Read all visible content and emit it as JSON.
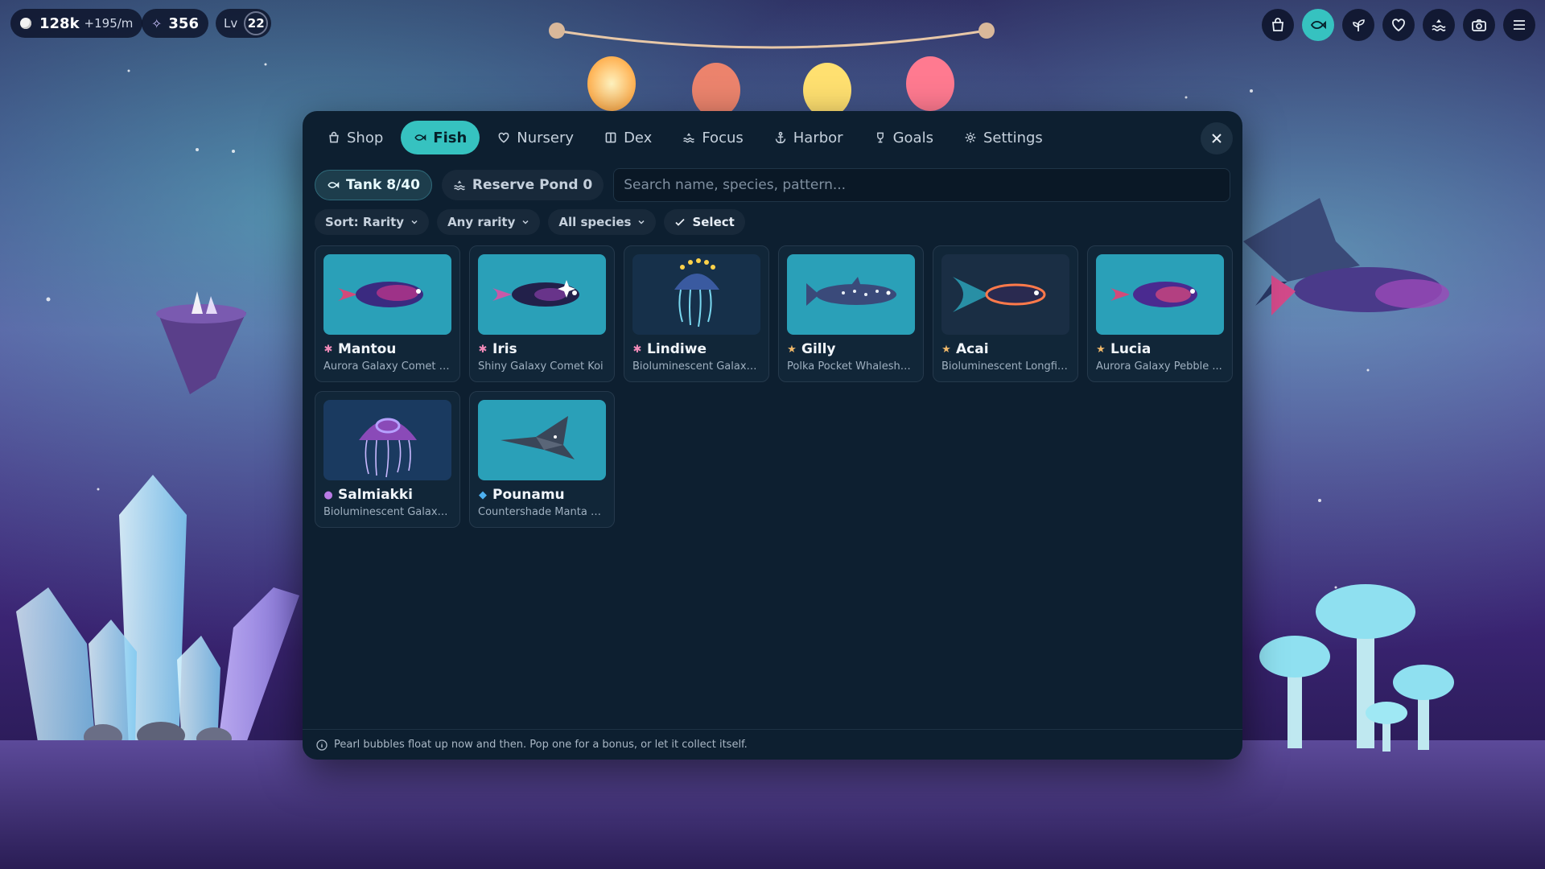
{
  "hud": {
    "coins": "128k",
    "coin_rate": "+195/m",
    "stardust": "356",
    "level_label": "Lv",
    "level": "22"
  },
  "top_rail": {
    "icons": [
      "shopping-bag-icon",
      "fish-icon",
      "sprout-icon",
      "heart-icon",
      "water-icon",
      "camera-icon",
      "menu-icon"
    ],
    "active": "fish-icon"
  },
  "tabs": [
    {
      "label": "Shop",
      "icon": "shopping-bag-icon"
    },
    {
      "label": "Fish",
      "icon": "fish-icon",
      "active": true
    },
    {
      "label": "Nursery",
      "icon": "heart-icon"
    },
    {
      "label": "Dex",
      "icon": "book-icon"
    },
    {
      "label": "Focus",
      "icon": "waves-icon"
    },
    {
      "label": "Harbor",
      "icon": "anchor-icon"
    },
    {
      "label": "Goals",
      "icon": "trophy-icon"
    },
    {
      "label": "Settings",
      "icon": "gear-icon"
    }
  ],
  "pond_toggle": {
    "tank_label": "Tank 8/40",
    "reserve_label": "Reserve Pond 0"
  },
  "search": {
    "placeholder": "Search name, species, pattern...",
    "value": ""
  },
  "filters": {
    "sort": "Sort: Rarity",
    "rarity": "Any rarity",
    "species": "All species",
    "select": "Select"
  },
  "fish": [
    {
      "name": "Mantou",
      "species": "Aurora Galaxy Comet K...",
      "rarity_icon": "✱",
      "rarity_color": "#f08ab8",
      "kind": "comet"
    },
    {
      "name": "Iris",
      "species": "Shiny Galaxy Comet Koi",
      "rarity_icon": "✱",
      "rarity_color": "#f08ab8",
      "kind": "koi-shiny"
    },
    {
      "name": "Lindiwe",
      "species": "Bioluminescent Galaxy ...",
      "rarity_icon": "✱",
      "rarity_color": "#f08ab8",
      "kind": "jelly-crown"
    },
    {
      "name": "Gilly",
      "species": "Polka Pocket Whalesha...",
      "rarity_icon": "★",
      "rarity_color": "#f0b86a",
      "kind": "whaleshark"
    },
    {
      "name": "Acai",
      "species": "Bioluminescent Longfin...",
      "rarity_icon": "★",
      "rarity_color": "#f0b86a",
      "kind": "longfin"
    },
    {
      "name": "Lucia",
      "species": "Aurora Galaxy Pebble ...",
      "rarity_icon": "★",
      "rarity_color": "#f0b86a",
      "kind": "pebble"
    },
    {
      "name": "Salmiakki",
      "species": "Bioluminescent Galaxy ...",
      "rarity_icon": "●",
      "rarity_color": "#b97be6",
      "kind": "jelly"
    },
    {
      "name": "Pounamu",
      "species": "Countershade Manta Ray",
      "rarity_icon": "◆",
      "rarity_color": "#4db0f0",
      "kind": "manta"
    }
  ],
  "footer_tip": "Pearl bubbles float up now and then. Pop one for a bonus, or let it collect itself.",
  "colors": {
    "accent": "#36c2c0",
    "panel": "#0d1f30",
    "card": "#112638"
  }
}
